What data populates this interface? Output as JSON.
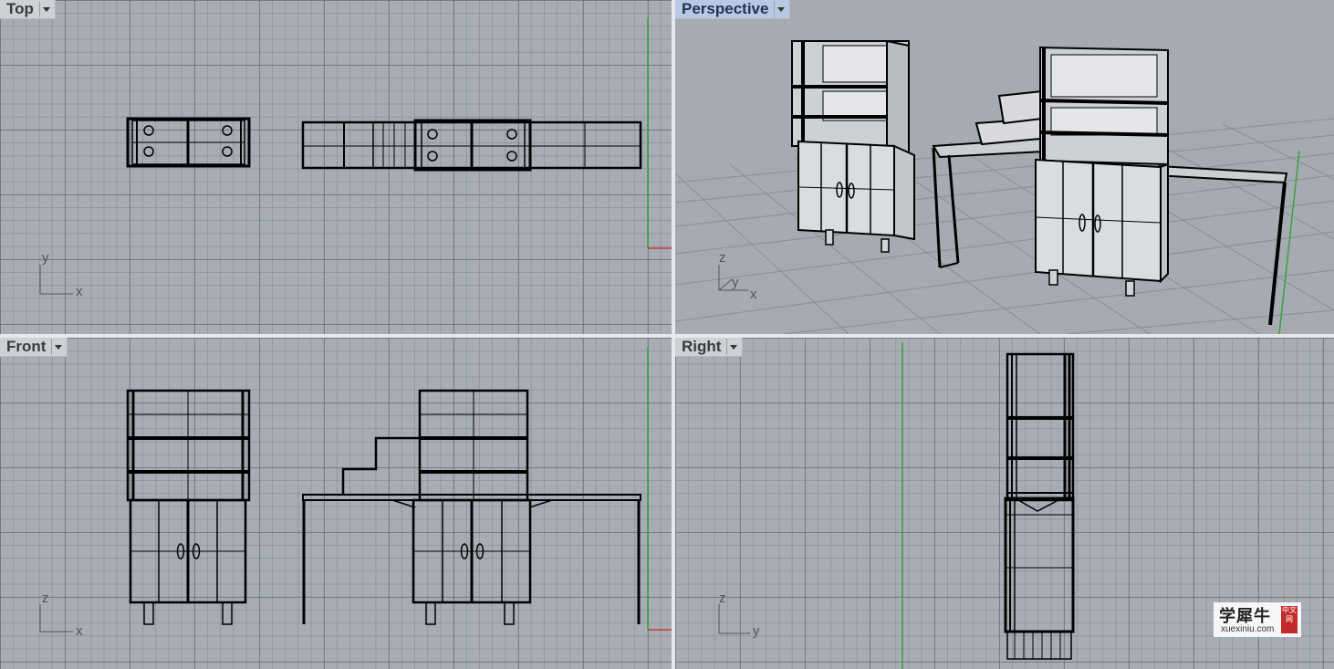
{
  "viewports": {
    "top": {
      "label": "Top",
      "axis_h": "x",
      "axis_v": "y"
    },
    "perspective": {
      "label": "Perspective",
      "axis_x": "x",
      "axis_y": "y",
      "axis_z": "z"
    },
    "front": {
      "label": "Front",
      "axis_h": "x",
      "axis_v": "z"
    },
    "right": {
      "label": "Right",
      "axis_h": "y",
      "axis_v": "z"
    }
  },
  "watermark": {
    "name": "学犀牛",
    "url": "xuexiniu.com",
    "seal": "中文网"
  },
  "colors": {
    "viewport_bg": "#a8adb5",
    "active_label": "#b8c9e3",
    "grid_green": "#3aa03a",
    "grid_red": "#c23a3a"
  },
  "icons": {
    "dropdown": "chevron-down-icon"
  }
}
